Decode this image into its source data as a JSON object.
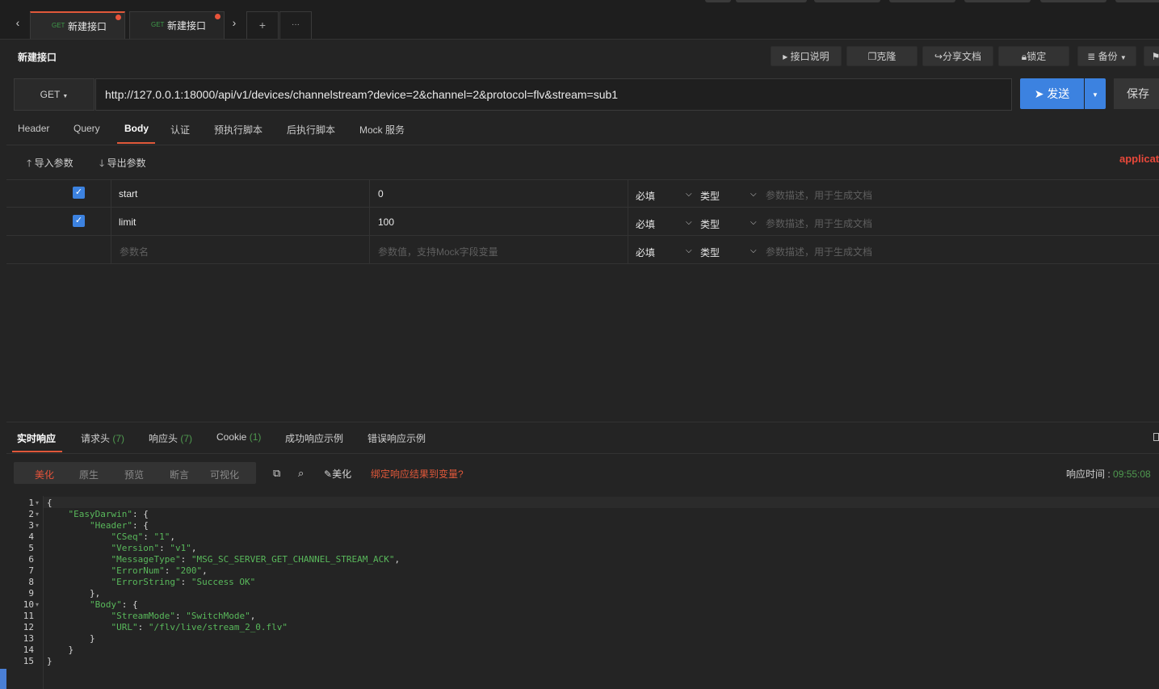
{
  "tabs": [
    {
      "method": "GET",
      "name": "新建接口",
      "active": true
    },
    {
      "method": "GET",
      "name": "新建接口",
      "active": false
    }
  ],
  "tab_controls": {
    "prev": "‹",
    "next": "›",
    "add": "+",
    "more": "···"
  },
  "title": "新建接口",
  "title_buttons": {
    "doc": "接口说明",
    "clone": "克隆",
    "share": "分享文档",
    "lock": "锁定",
    "backup": "备份"
  },
  "request": {
    "method": "GET",
    "url": "http://127.0.0.1:18000/api/v1/devices/channelstream?device=2&channel=2&protocol=flv&stream=sub1",
    "send": "发送",
    "save": "保存"
  },
  "request_tabs": [
    "Header",
    "Query",
    "Body",
    "认证",
    "预执行脚本",
    "后执行脚本",
    "Mock 服务"
  ],
  "active_request_tab": "Body",
  "body_tools": {
    "import": "导入参数",
    "export": "导出参数",
    "content_type": "applicati"
  },
  "params": [
    {
      "checked": true,
      "name": "start",
      "value": "0",
      "required": "必填",
      "type": "类型",
      "desc_placeholder": "参数描述，用于生成文档"
    },
    {
      "checked": true,
      "name": "limit",
      "value": "100",
      "required": "必填",
      "type": "类型",
      "desc_placeholder": "参数描述，用于生成文档"
    }
  ],
  "new_param": {
    "name_placeholder": "参数名",
    "value_placeholder": "参数值，支持Mock字段变量",
    "required": "必填",
    "type": "类型",
    "desc_placeholder": "参数描述，用于生成文档"
  },
  "response_tabs": [
    {
      "label": "实时响应",
      "count": ""
    },
    {
      "label": "请求头",
      "count": "(7)"
    },
    {
      "label": "响应头",
      "count": "(7)"
    },
    {
      "label": "Cookie",
      "count": "(1)"
    },
    {
      "label": "成功响应示例",
      "count": ""
    },
    {
      "label": "错误响应示例",
      "count": ""
    }
  ],
  "response_views": [
    "美化",
    "原生",
    "预览",
    "断言",
    "可视化"
  ],
  "active_response_view": "美化",
  "response_tools": {
    "beautify": "美化",
    "bind": "绑定响应结果到变量?"
  },
  "response_time": {
    "label": "响应时间 : ",
    "value": "09:55:08"
  },
  "code_lines": [
    "{",
    "    \"EasyDarwin\": {",
    "        \"Header\": {",
    "            \"CSeq\": \"1\",",
    "            \"Version\": \"v1\",",
    "            \"MessageType\": \"MSG_SC_SERVER_GET_CHANNEL_STREAM_ACK\",",
    "            \"ErrorNum\": \"200\",",
    "            \"ErrorString\": \"Success OK\"",
    "        },",
    "        \"Body\": {",
    "            \"StreamMode\": \"SwitchMode\",",
    "            \"URL\": \"/flv/live/stream_2_0.flv\"",
    "        }",
    "    }",
    "}"
  ],
  "line_numbers": [
    "1",
    "2",
    "3",
    "4",
    "5",
    "6",
    "7",
    "8",
    "9",
    "10",
    "11",
    "12",
    "13",
    "14",
    "15"
  ],
  "fold_lines": [
    1,
    2,
    3,
    10
  ],
  "colors": {
    "accent": "#e0583a",
    "primary": "#3c82e0",
    "green": "#59b85b",
    "background": "#242424"
  }
}
